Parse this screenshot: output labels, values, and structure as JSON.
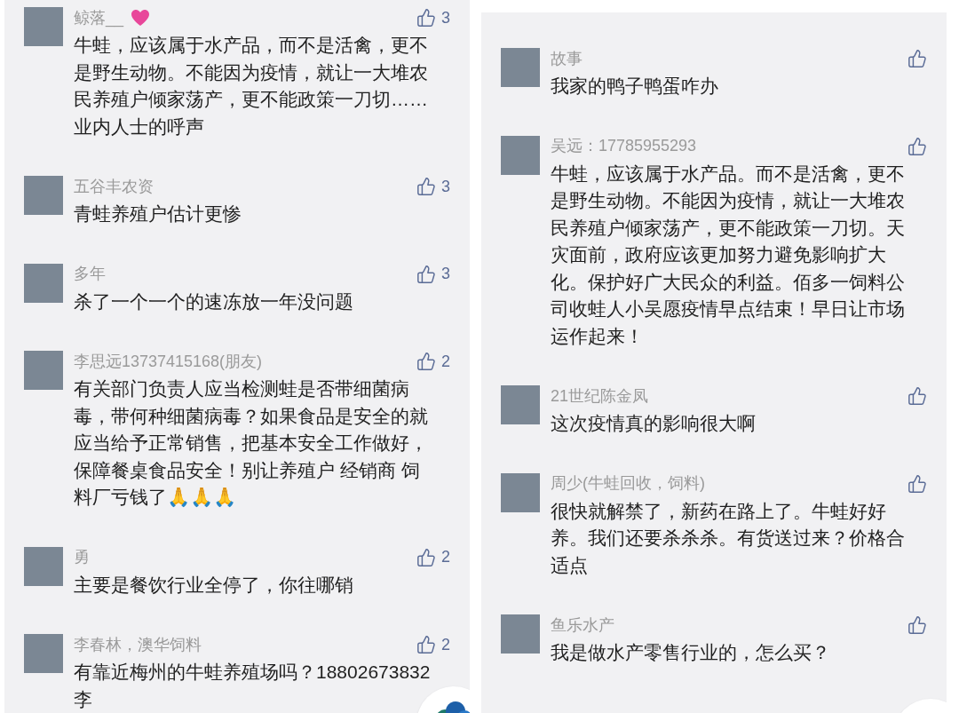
{
  "panels": [
    {
      "comments": [
        {
          "name": "鲸落__",
          "heart_badge": true,
          "likes": "3",
          "text": "牛蛙，应该属于水产品，而不是活禽，更不是野生动物。不能因为疫情，就让一大堆农民养殖户倾家荡产，更不能政策一刀切……业内人士的呼声"
        },
        {
          "name": "五谷丰农资",
          "heart_badge": false,
          "likes": "3",
          "text": "青蛙养殖户估计更惨"
        },
        {
          "name": "多年",
          "heart_badge": false,
          "likes": "3",
          "text": "杀了一个一个的速冻放一年没问题"
        },
        {
          "name": "李思远13737415168(朋友)",
          "heart_badge": false,
          "likes": "2",
          "text": "有关部门负责人应当检测蛙是否带细菌病毒，带何种细菌病毒？如果食品是安全的就应当给予正常销售，把基本安全工作做好，保障餐桌食品安全！别让养殖户 经销商 饲料厂亏钱了🙏🙏🙏"
        },
        {
          "name": "勇",
          "heart_badge": false,
          "likes": "2",
          "text": "主要是餐饮行业全停了，你往哪销"
        },
        {
          "name": "李春林，澳华饲料",
          "heart_badge": false,
          "likes": "2",
          "text": "有靠近梅州的牛蛙养殖场吗？18802673832 李"
        }
      ]
    },
    {
      "comments": [
        {
          "name": "故事",
          "heart_badge": false,
          "text": "我家的鸭子鸭蛋咋办"
        },
        {
          "name": "吴远：17785955293",
          "heart_badge": false,
          "text": "牛蛙，应该属于水产品。而不是活禽，更不是野生动物。不能因为疫情，就让一大堆农民养殖户倾家荡产，更不能政策一刀切。天灾面前，政府应该更加努力避免影响扩大化。保护好广大民众的利益。佰多一饲料公司收蛙人小吴愿疫情早点结束！早日让市场运作起来！"
        },
        {
          "name": "21世纪陈金凤",
          "heart_badge": false,
          "text": "这次疫情真的影响很大啊"
        },
        {
          "name": "周少(牛蛙回收，饲料)",
          "heart_badge": false,
          "text": "很快就解禁了，新药在路上了。牛蛙好好养。我们还要杀杀杀。有货送过来？价格合适点"
        },
        {
          "name": "鱼乐水产",
          "heart_badge": false,
          "text": "我是做水产零售行业的，怎么买？"
        }
      ]
    }
  ]
}
